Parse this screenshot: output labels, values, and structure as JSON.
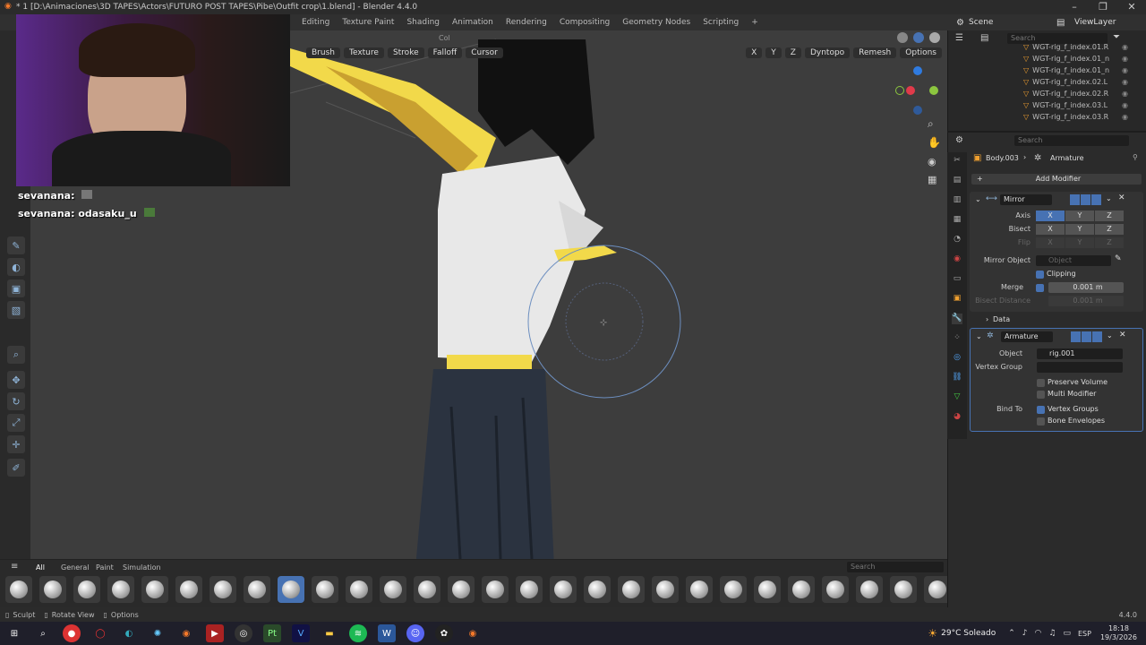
{
  "window": {
    "title": "* 1 [D:\\Animaciones\\3D TAPES\\Actors\\FUTURO POST TAPES\\Pibe\\Outfit crop\\1.blend] - Blender 4.4.0"
  },
  "workspaces": [
    "Editing",
    "Texture Paint",
    "Shading",
    "Animation",
    "Rendering",
    "Compositing",
    "Geometry Nodes",
    "Scripting"
  ],
  "scene": {
    "label": "Scene",
    "viewlayer": "ViewLayer"
  },
  "viewport_header": {
    "brush": "Brush",
    "texture": "Texture",
    "stroke": "Stroke",
    "falloff": "Falloff",
    "cursor": "Cursor",
    "axis_x": "X",
    "axis_y": "Y",
    "axis_z": "Z",
    "dyntopo": "Dyntopo",
    "remesh": "Remesh",
    "options": "Options",
    "col": "Col"
  },
  "chat": [
    {
      "user": "sevanana:",
      "message": ""
    },
    {
      "user": "sevanana:",
      "message": "odasaku_u"
    }
  ],
  "outliner": {
    "search_placeholder": "Search",
    "items": [
      "WGT-rig_f_index.01.R",
      "WGT-rig_f_index.01_n",
      "WGT-rig_f_index.01_n",
      "WGT-rig_f_index.02.L",
      "WGT-rig_f_index.02.R",
      "WGT-rig_f_index.03.L",
      "WGT-rig_f_index.03.R"
    ]
  },
  "properties": {
    "search_placeholder": "Search",
    "breadcrumb_object": "Body.003",
    "breadcrumb_modifier": "Armature",
    "add_modifier": "Add Modifier",
    "mirror": {
      "name": "Mirror",
      "axis_label": "Axis",
      "bisect_label": "Bisect",
      "flip_label": "Flip",
      "x": "X",
      "y": "Y",
      "z": "Z",
      "mirror_object_label": "Mirror Object",
      "mirror_object_placeholder": "Object",
      "clipping": "Clipping",
      "merge_label": "Merge",
      "merge_value": "0.001 m",
      "bisect_distance_label": "Bisect Distance",
      "bisect_distance_value": "0.001 m",
      "data_label": "Data"
    },
    "armature": {
      "name": "Armature",
      "object_label": "Object",
      "object_value": "rig.001",
      "vertex_group_label": "Vertex Group",
      "preserve_volume": "Preserve Volume",
      "multi_modifier": "Multi Modifier",
      "bind_to_label": "Bind To",
      "vertex_groups": "Vertex Groups",
      "bone_envelopes": "Bone Envelopes"
    }
  },
  "brush_shelf": {
    "tabs": [
      "All",
      "General",
      "Paint",
      "Simulation"
    ],
    "search_placeholder": "Search",
    "brush_count": 28
  },
  "statusbar": {
    "sculpt": "Sculpt",
    "rotate_view": "Rotate View",
    "options": "Options",
    "version": "4.4.0"
  },
  "taskbar": {
    "weather": "29°C  Soleado",
    "lang": "ESP",
    "time": "18:18",
    "date": "19/3/2026"
  },
  "colors": {
    "accent": "#4772b3",
    "skin": "#f2d94a",
    "shirt": "#e8e8e8",
    "pants": "#2b3340"
  }
}
